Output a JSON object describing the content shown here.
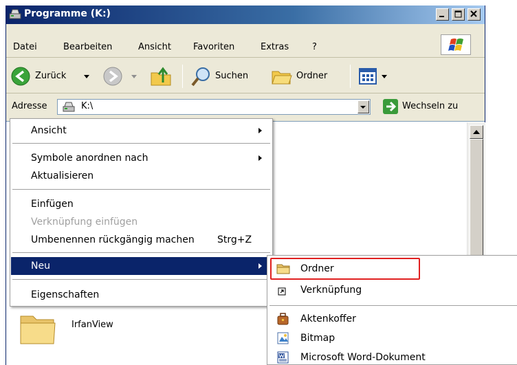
{
  "window": {
    "title": "Programme (K:)"
  },
  "menubar": {
    "items": [
      "Datei",
      "Bearbeiten",
      "Ansicht",
      "Favoriten",
      "Extras",
      "?"
    ]
  },
  "toolbar": {
    "back_label": "Zurück",
    "search_label": "Suchen",
    "folders_label": "Ordner"
  },
  "address": {
    "label": "Adresse",
    "value": "K:\\",
    "go_label": "Wechseln zu"
  },
  "context_menu": {
    "items": [
      {
        "label": "Ansicht"
      },
      {
        "label": "Symbole anordnen nach"
      },
      {
        "label": "Aktualisieren"
      },
      {
        "label": "Einfügen"
      },
      {
        "label": "Verknüpfung einfügen"
      },
      {
        "label": "Umbenennen rückgängig machen",
        "shortcut": "Strg+Z"
      },
      {
        "label": "Neu"
      },
      {
        "label": "Eigenschaften"
      }
    ]
  },
  "submenu": {
    "items": [
      {
        "label": "Ordner",
        "icon": "folder-icon"
      },
      {
        "label": "Verknüpfung",
        "icon": "shortcut-icon"
      },
      {
        "label": "Aktenkoffer",
        "icon": "briefcase-icon"
      },
      {
        "label": "Bitmap",
        "icon": "bitmap-icon"
      },
      {
        "label": "Microsoft Word-Dokument",
        "icon": "word-document-icon"
      }
    ]
  },
  "files": [
    {
      "name": "IrfanView",
      "icon": "folder-icon"
    }
  ],
  "colors": {
    "title_start": "#0a246a",
    "title_end": "#a6caf0",
    "menu_highlight": "#0a246a",
    "annotation_box": "#e02020"
  }
}
